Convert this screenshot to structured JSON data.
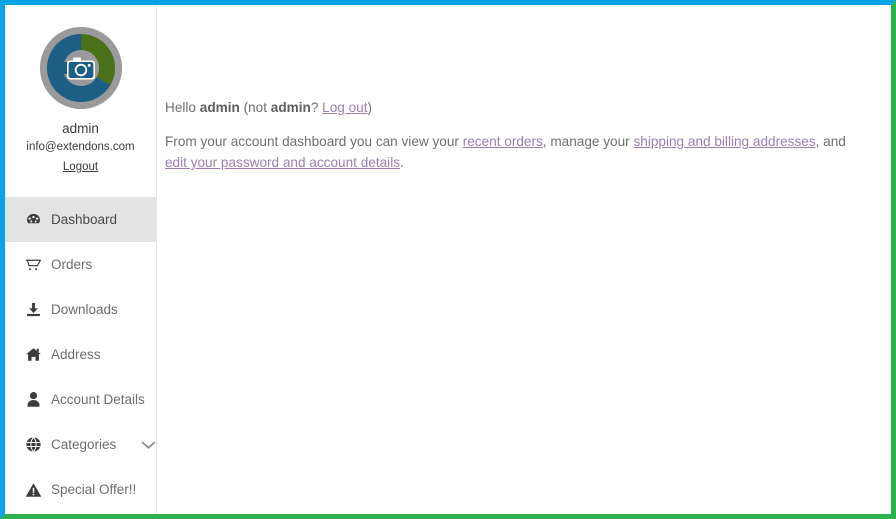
{
  "window": {
    "border_top_color": "#0aa3e8",
    "border_left_color": "#0aa3e8",
    "border_right_color": "#2bb24c",
    "border_bottom_color": "#2bb24c"
  },
  "sidebar": {
    "avatar": {
      "icon": "camera-avatar-placeholder",
      "ring_gray": "#9a9a9a",
      "ring_blue": "#1d5f84",
      "ring_green": "#4a7019"
    },
    "user_name": "admin",
    "user_email": "info@extendons.com",
    "logout_label": "Logout",
    "items": [
      {
        "label": "Dashboard",
        "icon": "dashboard-gauge-icon",
        "active": true,
        "has_chevron": false
      },
      {
        "label": "Orders",
        "icon": "shopping-cart-icon",
        "active": false,
        "has_chevron": false
      },
      {
        "label": "Downloads",
        "icon": "download-icon",
        "active": false,
        "has_chevron": false
      },
      {
        "label": "Address",
        "icon": "home-icon",
        "active": false,
        "has_chevron": false
      },
      {
        "label": "Account Details",
        "icon": "user-icon",
        "active": false,
        "has_chevron": false
      },
      {
        "label": "Categories",
        "icon": "globe-icon",
        "active": false,
        "has_chevron": true
      },
      {
        "label": "Special Offer!!",
        "icon": "warning-triangle-icon",
        "active": false,
        "has_chevron": false
      }
    ]
  },
  "main": {
    "greeting": {
      "hello_prefix": "Hello ",
      "user_bold": "admin",
      "not_prefix": " (not ",
      "not_user_bold": "admin",
      "question": "? ",
      "logout_link": "Log out",
      "close_paren": ")"
    },
    "description": {
      "part1": "From your account dashboard you can view your ",
      "link_recent_orders": "recent orders",
      "part2": ", manage your ",
      "link_addresses": "shipping and billing addresses",
      "part3": ", and ",
      "link_edit": "edit your password and account details",
      "part4": "."
    },
    "link_color": "#9a7fb0",
    "text_color": "#6f6f6f"
  }
}
